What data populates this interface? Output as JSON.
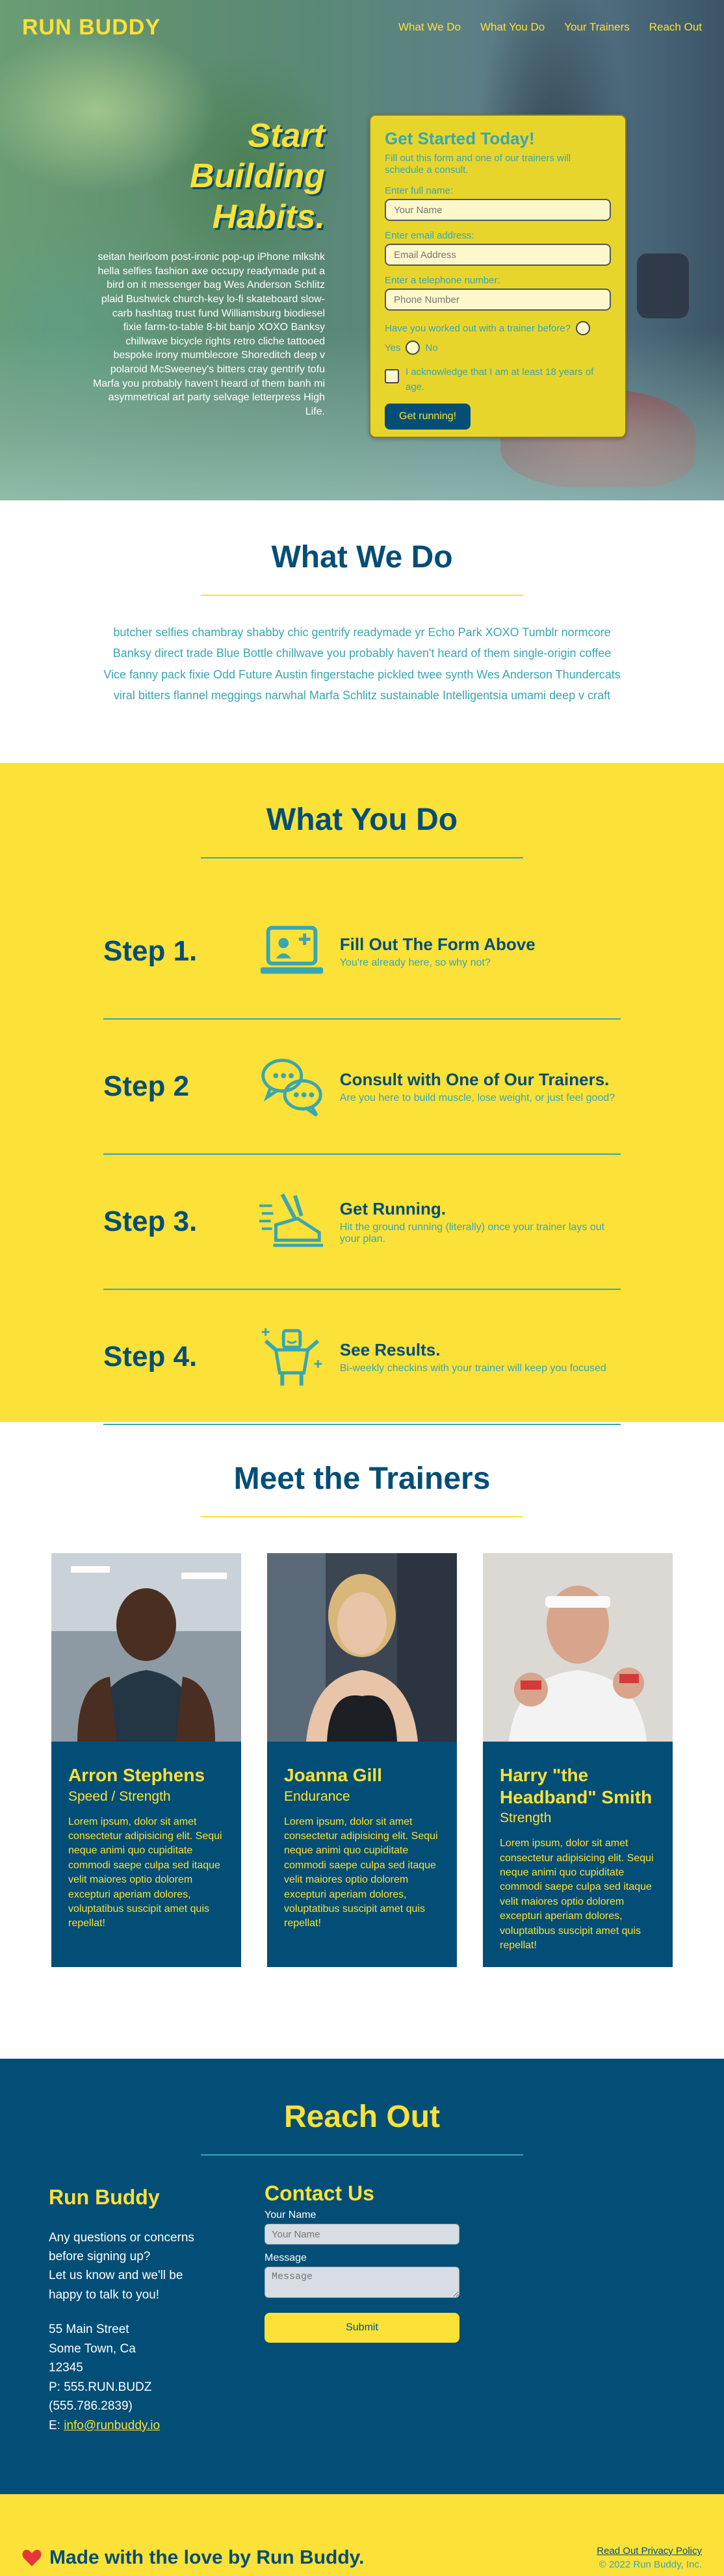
{
  "brand": "RUN BUDDY",
  "nav": [
    "What We Do",
    "What You Do",
    "Your Trainers",
    "Reach Out"
  ],
  "hero": {
    "headline": [
      "Start",
      "Building",
      "Habits."
    ],
    "body": "seitan heirloom post-ironic pop-up iPhone mlkshk hella selfies fashion axe occupy readymade put a bird on it messenger bag Wes Anderson Schlitz plaid Bushwick church-key lo-fi skateboard slow-carb hashtag trust fund Williamsburg biodiesel fixie farm-to-table 8-bit banjo XOXO Banksy chillwave bicycle rights retro cliche tattooed bespoke irony mumblecore Shoreditch deep v polaroid McSweeney's bitters cray gentrify tofu Marfa you probably haven't heard of them banh mi asymmetrical art party selvage letterpress High Life."
  },
  "form": {
    "title": "Get Started Today!",
    "subtitle": "Fill out this form and one of our trainers will schedule a consult.",
    "name_label": "Enter full name:",
    "name_placeholder": "Your Name",
    "email_label": "Enter email address:",
    "email_placeholder": "Email Address",
    "phone_label": "Enter a telephone number:",
    "phone_placeholder": "Phone Number",
    "question": "Have you worked out with a trainer before?",
    "yes": "Yes",
    "no": "No",
    "ack": "I acknowledge that I am at least 18 years of age.",
    "button": "Get running!"
  },
  "what_we_do": {
    "title": "What We Do",
    "body": "butcher selfies chambray shabby chic gentrify readymade yr Echo Park XOXO Tumblr normcore Banksy direct trade Blue Bottle chillwave you probably haven't heard of them single-origin coffee Vice fanny pack fixie Odd Future Austin fingerstache pickled twee synth Wes Anderson Thundercats viral bitters flannel meggings narwhal Marfa Schlitz sustainable Intelligentsia umami deep v craft"
  },
  "what_you_do": {
    "title": "What You Do",
    "steps": [
      {
        "num": "Step 1.",
        "title": "Fill Out The Form Above",
        "desc": "You're already here, so why not?",
        "icon": "laptop-add-icon"
      },
      {
        "num": "Step 2",
        "title": "Consult with One of Our Trainers.",
        "desc": "Are you here to build muscle, lose weight, or just feel good?",
        "icon": "chat-bubbles-icon"
      },
      {
        "num": "Step 3.",
        "title": "Get Running.",
        "desc": "Hit the ground running (literally) once your trainer lays out your plan.",
        "icon": "running-shoe-icon"
      },
      {
        "num": "Step 4.",
        "title": "See Results.",
        "desc": "Bi-weekly checkins with your trainer will keep you focused",
        "icon": "strong-body-icon"
      }
    ]
  },
  "trainers": {
    "title": "Meet the Trainers",
    "list": [
      {
        "name": "Arron Stephens",
        "role": "Speed / Strength",
        "bio": "Lorem ipsum, dolor sit amet consectetur adipisicing elit. Sequi neque animi quo cupiditate commodi saepe culpa sed itaque velit maiores optio dolorem excepturi aperiam dolores, voluptatibus suscipit amet quis repellat!"
      },
      {
        "name": "Joanna Gill",
        "role": "Endurance",
        "bio": "Lorem ipsum, dolor sit amet consectetur adipisicing elit. Sequi neque animi quo cupiditate commodi saepe culpa sed itaque velit maiores optio dolorem excepturi aperiam dolores, voluptatibus suscipit amet quis repellat!"
      },
      {
        "name": "Harry \"the Headband\" Smith",
        "role": "Strength",
        "bio": "Lorem ipsum, dolor sit amet consectetur adipisicing elit. Sequi neque animi quo cupiditate commodi saepe culpa sed itaque velit maiores optio dolorem excepturi aperiam dolores, voluptatibus suscipit amet quis repellat!"
      }
    ]
  },
  "reach": {
    "title": "Reach Out",
    "company": "Run Buddy",
    "question": "Any questions or concerns before signing up?",
    "invite": "Let us know and we'll be happy to talk to you!",
    "address": [
      "55 Main Street",
      "Some Town, Ca",
      "12345"
    ],
    "phone": "P: 555.RUN.BUDZ (555.786.2839)",
    "email_prefix": "E: ",
    "email": "info@runbuddy.io",
    "contact_title": "Contact Us",
    "name_label": "Your Name",
    "name_placeholder": "Your Name",
    "message_label": "Message",
    "message_placeholder": "Message",
    "submit": "Submit"
  },
  "footer": {
    "love": "Made with the love by Run Buddy.",
    "privacy": "Read Out Privacy Policy",
    "copyright": "© 2022 Run Buddy, Inc."
  },
  "colors": {
    "primary": "#024e76",
    "accent": "#fce138",
    "secondary": "#39a6b2"
  }
}
